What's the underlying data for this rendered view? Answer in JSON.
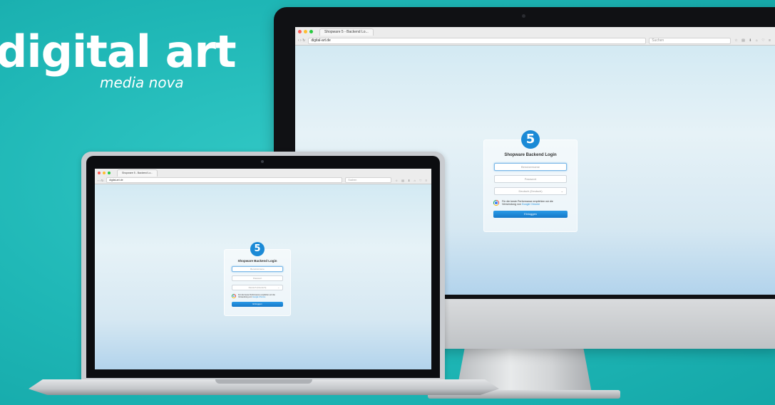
{
  "brand": {
    "title": "digital art",
    "subtitle": "media nova"
  },
  "imac": {
    "browser": {
      "tab_title": "Shopware 5 - Backend Lo...",
      "url": "digital-art.de",
      "search_placeholder": "Suchen",
      "tool_icons": "☆ ▤ ⬇ ⌂ ♡ ≡"
    },
    "login": {
      "logo_letter": "5",
      "title": "Shopware Backend Login",
      "username_placeholder": "Benutzername",
      "password_placeholder": "Passwort",
      "language_select": "Deutsch (Deutsch)",
      "note_text": "Für die beste Performance empfehlen wir die Verwendung von",
      "note_link": "Google Chrome",
      "login_button": "Einloggen"
    }
  },
  "laptop": {
    "browser": {
      "tab_title": "Shopware 5 - Backend Lo...",
      "url": "digital-art.de",
      "search_placeholder": "Suchen",
      "tool_icons": "☆ ▤ ⬇ ⌂ ♡ ≡"
    },
    "login": {
      "logo_letter": "5",
      "title": "Shopware Backend Login",
      "username_placeholder": "Benutzername",
      "password_placeholder": "Passwort",
      "language_select": "Deutsch (Deutsch)",
      "note_text": "Für die beste Performance empfehlen wir die Verwendung von",
      "note_link": "Google Chrome",
      "login_button": "Einloggen"
    }
  },
  "colors": {
    "background": "#1fb7b6",
    "accent": "#1b8ad6"
  }
}
